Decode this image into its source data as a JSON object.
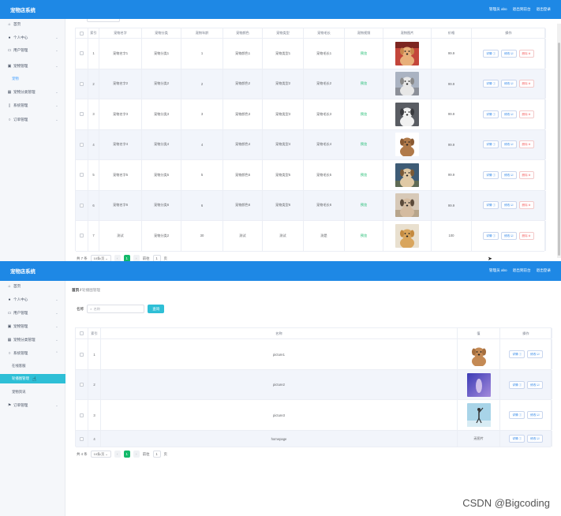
{
  "app": {
    "title": "宠物店系统"
  },
  "header_right": {
    "admin": "管理员 abo",
    "frontend": "退出到前台",
    "logout": "退出登录"
  },
  "panel1": {
    "menu": [
      {
        "icon": "home-icon",
        "label": "首页",
        "chev": ""
      },
      {
        "icon": "user-icon",
        "label": "个人中心",
        "chev": "⌄"
      },
      {
        "icon": "users-icon",
        "label": "用户管理",
        "chev": "⌄"
      },
      {
        "icon": "pet-icon",
        "label": "宠物管理",
        "chev": "⌄"
      },
      {
        "icon": "grid-icon",
        "label": "宠物分类管理",
        "chev": "⌄"
      },
      {
        "icon": "settings-icon",
        "label": "系统管理",
        "chev": "⌄"
      },
      {
        "icon": "order-icon",
        "label": "订单管理",
        "chev": "⌄"
      }
    ],
    "submenu": {
      "label": "宠物"
    },
    "table": {
      "headers": [
        "索引",
        "宠物名字",
        "宠物分类",
        "宠物年龄",
        "宠物颜色",
        "宠物类型",
        "宠物毛长",
        "宠物视频",
        "宠物图片",
        "价格",
        "操作"
      ],
      "rows": [
        {
          "idx": "1",
          "name": "宠物名字1",
          "cat": "宠物分类1",
          "age": "1",
          "color": "宠物颜色1",
          "type": "宠物类型1",
          "hair": "宠物毛长1",
          "video": "预览",
          "price": "99.9"
        },
        {
          "idx": "2",
          "name": "宠物名字2",
          "cat": "宠物分类2",
          "age": "2",
          "color": "宠物颜色2",
          "type": "宠物类型2",
          "hair": "宠物毛长2",
          "video": "预览",
          "price": "99.9"
        },
        {
          "idx": "3",
          "name": "宠物名字3",
          "cat": "宠物分类3",
          "age": "3",
          "color": "宠物颜色3",
          "type": "宠物类型3",
          "hair": "宠物毛长3",
          "video": "预览",
          "price": "99.9"
        },
        {
          "idx": "4",
          "name": "宠物名字4",
          "cat": "宠物分类4",
          "age": "4",
          "color": "宠物颜色4",
          "type": "宠物类型4",
          "hair": "宠物毛长4",
          "video": "预览",
          "price": "99.9"
        },
        {
          "idx": "5",
          "name": "宠物名字5",
          "cat": "宠物分类5",
          "age": "5",
          "color": "宠物颜色5",
          "type": "宠物类型5",
          "hair": "宠物毛长5",
          "video": "预览",
          "price": "99.9"
        },
        {
          "idx": "6",
          "name": "宠物名字6",
          "cat": "宠物分类6",
          "age": "6",
          "color": "宠物颜色6",
          "type": "宠物类型6",
          "hair": "宠物毛长6",
          "video": "预览",
          "price": "99.9"
        },
        {
          "idx": "7",
          "name": "测试",
          "cat": "宠物分类2",
          "age": "30",
          "color": "测试",
          "type": "测试",
          "hair": "测是",
          "video": "预览",
          "price": "100"
        }
      ],
      "ops": {
        "detail": "详情 ⓘ",
        "edit": "修改 ☑",
        "delete": "删除 ⊗"
      }
    },
    "pager": {
      "total": "共 7 条",
      "size": "10条/页 ⌄",
      "prev": "‹",
      "page": "1",
      "next": "›",
      "goto": "前往",
      "input": "1",
      "unit": "页"
    }
  },
  "panel2": {
    "menu": [
      {
        "icon": "home-icon",
        "label": "首页",
        "chev": ""
      },
      {
        "icon": "user-icon",
        "label": "个人中心",
        "chev": "⌄"
      },
      {
        "icon": "users-icon",
        "label": "用户管理",
        "chev": "⌄"
      },
      {
        "icon": "pet-icon",
        "label": "宠物管理",
        "chev": "⌄"
      },
      {
        "icon": "grid-icon",
        "label": "宠物分类管理",
        "chev": "⌄"
      },
      {
        "icon": "settings-icon",
        "label": "系统管理",
        "chev": "⌃"
      },
      {
        "icon": "flag-icon",
        "label": "订单管理",
        "chev": "⌄"
      }
    ],
    "submenu": [
      {
        "label": "在线客服"
      },
      {
        "label": "轮播图管理"
      },
      {
        "label": "宠物资讯"
      }
    ],
    "breadcrumb": {
      "home": "首页",
      "sep": "/",
      "current": "轮播图管理"
    },
    "search": {
      "label": "名称",
      "placeholder": "名称",
      "button": "查询"
    },
    "table": {
      "headers": [
        "索引",
        "名称",
        "值",
        "操作"
      ],
      "rows": [
        {
          "idx": "1",
          "name": "picture1",
          "value": ""
        },
        {
          "idx": "2",
          "name": "picture2",
          "value": ""
        },
        {
          "idx": "3",
          "name": "picture3",
          "value": ""
        },
        {
          "idx": "4",
          "name": "homepage",
          "value": "无图片"
        }
      ],
      "ops": {
        "detail": "详情 ⓘ",
        "edit": "修改 ☑"
      }
    },
    "pager": {
      "total": "共 4 条",
      "size": "10条/页 ⌄",
      "prev": "‹",
      "page": "1",
      "next": "›",
      "goto": "前往",
      "input": "1",
      "unit": "页"
    }
  },
  "watermark": "CSDN @Bigcoding"
}
